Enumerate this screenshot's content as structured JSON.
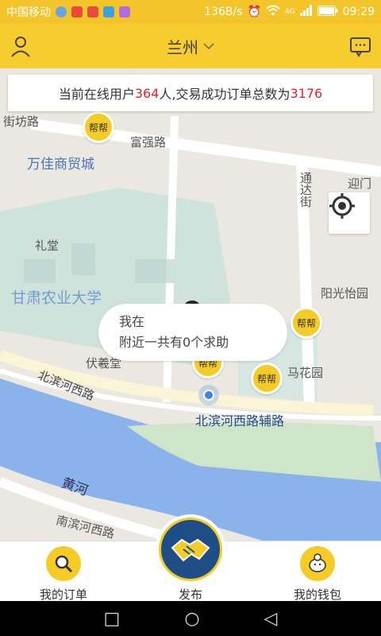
{
  "status_bar": {
    "carrier": "中国移动",
    "net_speed": "136B/s",
    "network": "4G",
    "time": "09:29"
  },
  "header": {
    "city": "兰州",
    "city_dropdown_icon": "chevron-down-icon",
    "user_icon": "user-icon",
    "message_icon": "message-icon"
  },
  "banner": {
    "prefix": "当前在线用户",
    "online_users": "364",
    "middle": "人,交易成功订单总数为",
    "orders_total": "3176"
  },
  "map": {
    "labels": {
      "jiefang": "街坊路",
      "fuqiang": "富强路",
      "wanjia": "万佳商贸城",
      "litang": "礼堂",
      "gansu_agri": "甘肃农业大学",
      "fuxi": "伏羲堂",
      "tongda": "通达街",
      "yingmen": "迎门",
      "yangguang": "阳光怡园",
      "huayuan": "马花园",
      "binhe_west": "北滨河西路",
      "binhe_aux": "北滨河西路辅路",
      "huanghe": "黄河",
      "nanbinhe": "南滨河西路"
    },
    "helper_badge_label": "帮帮",
    "bubble": {
      "line1": "我在",
      "line2": "附近一共有0个求助"
    },
    "locate_icon": "locate-icon"
  },
  "bottom_nav": {
    "orders": "我的订单",
    "publish": "发布",
    "wallet": "我的钱包"
  },
  "system_nav": {
    "back": "◁",
    "home": "○",
    "recent": "□"
  },
  "colors": {
    "accent": "#f7cc2e",
    "highlight_red": "#e8202a",
    "river": "#8ab3ec",
    "publish_blue": "#1f4d86"
  }
}
